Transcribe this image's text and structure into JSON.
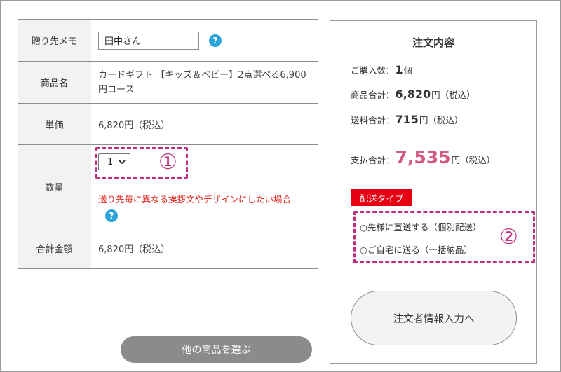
{
  "order": {
    "memo_label": "贈り先メモ",
    "memo_value": "田中さん",
    "help_glyph": "?",
    "product_label": "商品名",
    "product_value": "カードギフト 【キッズ＆ベビー】2点選べる6,900円コース",
    "price_label": "単価",
    "price_value": "6,820円（税込）",
    "qty_label": "数量",
    "qty_value": "1",
    "qty_note": "送り先毎に異なる挨拶文やデザインにしたい場合",
    "total_label": "合計金額",
    "total_value": "6,820円（税込）"
  },
  "annotations": {
    "one": "①",
    "two": "②",
    "color": "#c0307e"
  },
  "other_button": "他の商品を選ぶ",
  "summary": {
    "title": "注文内容",
    "count_label": "ご購入数：",
    "count_value": "1",
    "count_unit": "個",
    "goods_label": "商品合計：",
    "goods_value": "6,820",
    "ship_label": "送料合計：",
    "ship_value": "715",
    "pay_label": "支払合計：",
    "pay_value": "7,535",
    "yen_tax": "円（税込）",
    "delivery_tag": "配送タイプ",
    "option1": "○先様に直送する（個別配送）",
    "option2": "○ご自宅に送る（一括納品）",
    "next_button": "注文者情報入力へ"
  },
  "colors": {
    "help": "#2aa3d9",
    "note_red": "#e2231a",
    "total_pink": "#d25b83",
    "tag_red": "#e60012"
  }
}
